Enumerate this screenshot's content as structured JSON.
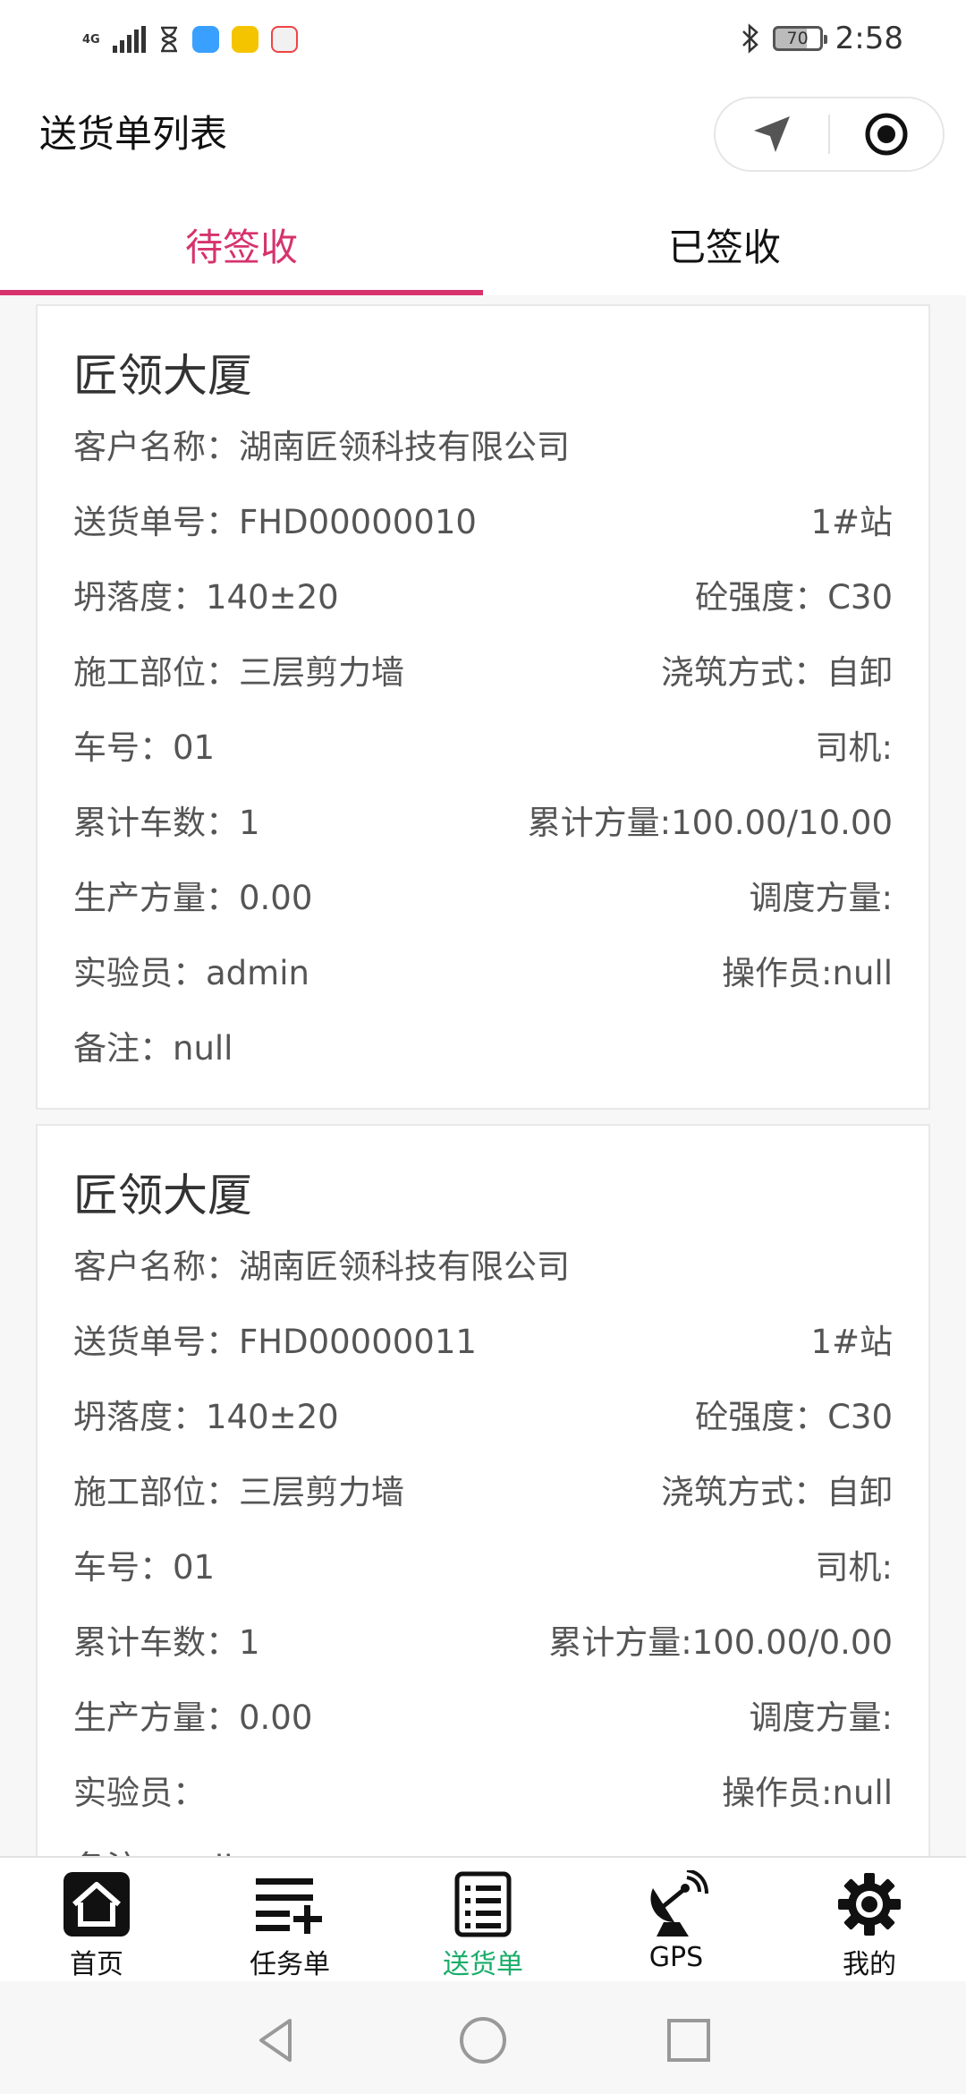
{
  "status_bar": {
    "network": "4G",
    "time": "2:58",
    "battery": "70"
  },
  "header": {
    "title": "送货单列表"
  },
  "tabs": [
    {
      "label": "待签收",
      "active": true
    },
    {
      "label": "已签收",
      "active": false
    }
  ],
  "cards": [
    {
      "title": "匠领大厦",
      "customer": "客户名称：湖南匠领科技有限公司",
      "order_no": "送货单号：FHD00000010",
      "station": "1#站",
      "slump": "坍落度：140±20",
      "strength": "砼强度：C30",
      "position": "施工部位：三层剪力墙",
      "pour_method": "浇筑方式：自卸",
      "truck_no": "车号：01",
      "driver": "司机:",
      "total_trips": "累计车数：1",
      "total_volume": "累计方量:100.00/10.00",
      "production_volume": "生产方量：0.00",
      "dispatch_volume": "调度方量:",
      "tester": "实验员：admin",
      "operator": "操作员:null",
      "remark": "备注：null"
    },
    {
      "title": "匠领大厦",
      "customer": "客户名称：湖南匠领科技有限公司",
      "order_no": "送货单号：FHD00000011",
      "station": "1#站",
      "slump": "坍落度：140±20",
      "strength": "砼强度：C30",
      "position": "施工部位：三层剪力墙",
      "pour_method": "浇筑方式：自卸",
      "truck_no": "车号：01",
      "driver": "司机:",
      "total_trips": "累计车数：1",
      "total_volume": "累计方量:100.00/0.00",
      "production_volume": "生产方量：0.00",
      "dispatch_volume": "调度方量:",
      "tester": "实验员：",
      "operator": "操作员:null",
      "remark": "备注：null"
    }
  ],
  "bottom_nav": [
    {
      "label": "首页",
      "icon": "home-icon",
      "active": false
    },
    {
      "label": "任务单",
      "icon": "task-list-add-icon",
      "active": false
    },
    {
      "label": "送货单",
      "icon": "delivery-list-icon",
      "active": true
    },
    {
      "label": "GPS",
      "icon": "satellite-dish-icon",
      "active": false
    },
    {
      "label": "我的",
      "icon": "gear-icon",
      "active": false
    }
  ],
  "colors": {
    "accent": "#d6336c",
    "nav_active": "#1aad6a"
  }
}
